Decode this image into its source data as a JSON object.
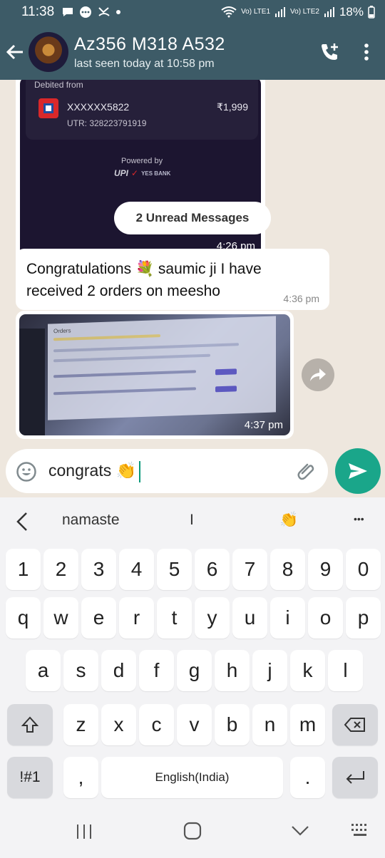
{
  "status_bar": {
    "time": "11:38",
    "battery": "18%",
    "sim1": "Vo) LTE1",
    "sim2": "Vo) LTE2"
  },
  "header": {
    "title": "Az356 M318 A532",
    "subtitle": "last seen today at 10:58 pm"
  },
  "payment": {
    "debited_from": "Debited from",
    "account": "XXXXXX5822",
    "amount": "₹1,999",
    "utr": "UTR: 328223791919",
    "powered_by": "Powered by",
    "upi": "UPI",
    "bank": "YES BANK",
    "time": "4:26 pm"
  },
  "unread_banner": "2 Unread Messages",
  "message": {
    "text_before": "Congratulations ",
    "emoji": "💐",
    "text_after": " saumic ji I have received 2 orders on meesho",
    "time": "4:36 pm"
  },
  "image_message": {
    "screen_title": "Orders",
    "time": "4:37 pm"
  },
  "compose": {
    "text": "congrats 👏"
  },
  "keyboard": {
    "suggestions": [
      "namaste",
      "I",
      "👏"
    ],
    "more": "•••",
    "row_numbers": [
      "1",
      "2",
      "3",
      "4",
      "5",
      "6",
      "7",
      "8",
      "9",
      "0"
    ],
    "row1": [
      "q",
      "w",
      "e",
      "r",
      "t",
      "y",
      "u",
      "i",
      "o",
      "p"
    ],
    "row2": [
      "a",
      "s",
      "d",
      "f",
      "g",
      "h",
      "j",
      "k",
      "l"
    ],
    "row3": [
      "z",
      "x",
      "c",
      "v",
      "b",
      "n",
      "m"
    ],
    "symbols_label": "!#1",
    "comma": ",",
    "space_label": "English(India)",
    "period": "."
  },
  "colors": {
    "header": "#3d5b67",
    "send": "#1aa68a",
    "chat_bg": "#eee7de"
  }
}
